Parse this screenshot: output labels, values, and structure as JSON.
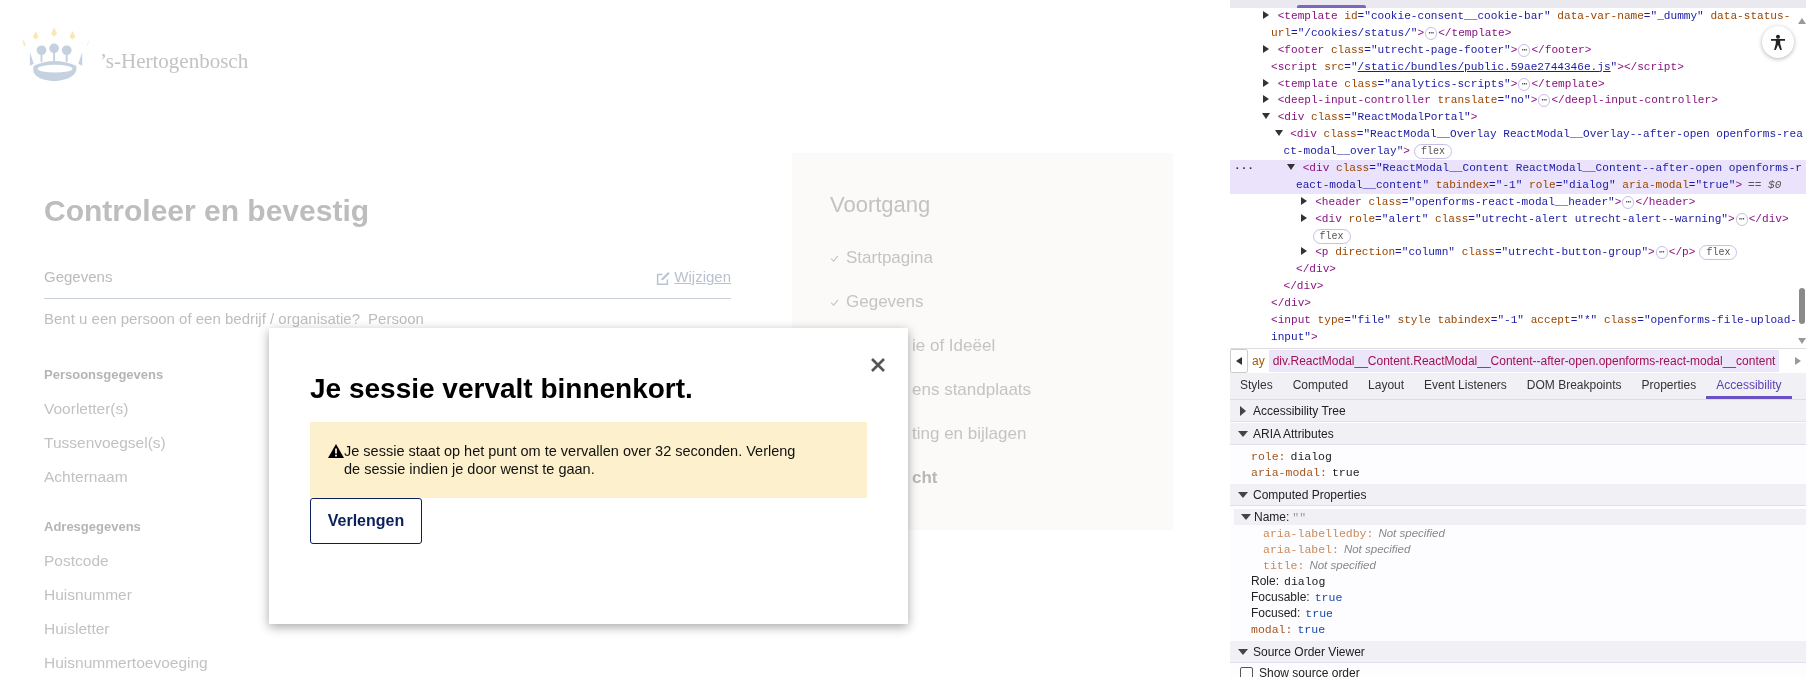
{
  "site": {
    "name": "’s-Hertogenbosch"
  },
  "summary": {
    "title": "Controleer en bevestig",
    "section_label": "Gegevens",
    "edit_link": "Wijzigen",
    "question": "Bent u een persoon of een bedrijf / organisatie?",
    "answer": "Persoon",
    "groups": [
      {
        "heading": "Persoonsgegevens",
        "fields": [
          "Voorletter(s)",
          "Tussenvoegsel(s)",
          "Achternaam"
        ]
      },
      {
        "heading": "Adresgegevens",
        "fields": [
          "Postcode",
          "Huisnummer",
          "Huisletter",
          "Huisnummertoevoeging"
        ]
      }
    ]
  },
  "progress": {
    "title": "Voortgang",
    "steps": [
      {
        "label": "Startpagina",
        "kind": "full",
        "done": true,
        "current": false
      },
      {
        "label": "Gegevens",
        "kind": "full",
        "done": true,
        "current": false
      },
      {
        "label": "ie of Ideëel",
        "kind": "covered",
        "done": false,
        "current": false
      },
      {
        "label": "ens standplaats",
        "kind": "covered",
        "done": false,
        "current": false
      },
      {
        "label": "ting en bijlagen",
        "kind": "covered",
        "done": false,
        "current": false
      },
      {
        "label": "cht",
        "kind": "covered",
        "done": false,
        "current": true
      }
    ]
  },
  "modal": {
    "title": "Je sessie vervalt binnenkort.",
    "alert": "Je sessie staat op het punt om te vervallen over 32 seconden. Verleng de sessie indien je door wenst te gaan.",
    "button": "Verlengen"
  },
  "devtools": {
    "dom_tree": [
      {
        "kind": "branch",
        "expanded": false,
        "selected": false,
        "lines": [
          [
            {
              "kind": "tag",
              "text": "<template"
            },
            {
              "kind": "attr",
              "text": " id"
            },
            {
              "kind": "value",
              "text": "=\"cookie-consent__cookie-bar\""
            },
            {
              "kind": "attr",
              "text": " data-var-name"
            },
            {
              "kind": "value",
              "text": "=\"_dummy\""
            },
            {
              "kind": "attr",
              "text": " data-status-"
            }
          ],
          [
            {
              "kind": "attr",
              "text": "url"
            },
            {
              "kind": "value",
              "text": "=\"/cookies/status/\""
            },
            {
              "kind": "tag",
              "text": ">"
            },
            {
              "kind": "ellipsis",
              "text": "⋯"
            },
            {
              "kind": "tag",
              "text": "</template>"
            }
          ]
        ]
      },
      {
        "kind": "branch",
        "expanded": false,
        "selected": false,
        "lines": [
          [
            {
              "kind": "tag",
              "text": "<footer"
            },
            {
              "kind": "attr",
              "text": " class"
            },
            {
              "kind": "value",
              "text": "=\"utrecht-page-footer\""
            },
            {
              "kind": "tag",
              "text": ">"
            },
            {
              "kind": "ellipsis",
              "text": "⋯"
            },
            {
              "kind": "tag",
              "text": "</footer>"
            }
          ]
        ]
      },
      {
        "kind": "leaf",
        "selected": false,
        "lines": [
          [
            {
              "kind": "tag",
              "text": "<script"
            },
            {
              "kind": "attr",
              "text": " src"
            },
            {
              "kind": "value",
              "text": "=\""
            },
            {
              "kind": "link",
              "text": "/static/bundles/public.59ae2744346e.js"
            },
            {
              "kind": "value",
              "text": "\""
            },
            {
              "kind": "tag",
              "text": "></script>"
            }
          ]
        ]
      },
      {
        "kind": "branch",
        "expanded": false,
        "selected": false,
        "lines": [
          [
            {
              "kind": "tag",
              "text": "<template"
            },
            {
              "kind": "attr",
              "text": " class"
            },
            {
              "kind": "value",
              "text": "=\"analytics-scripts\""
            },
            {
              "kind": "tag",
              "text": ">"
            },
            {
              "kind": "ellipsis",
              "text": "⋯"
            },
            {
              "kind": "tag",
              "text": "</template>"
            }
          ]
        ]
      },
      {
        "kind": "branch",
        "expanded": false,
        "selected": false,
        "lines": [
          [
            {
              "kind": "tag",
              "text": "<deepl-input-controller"
            },
            {
              "kind": "attr",
              "text": " translate"
            },
            {
              "kind": "value",
              "text": "=\"no\""
            },
            {
              "kind": "tag",
              "text": ">"
            },
            {
              "kind": "ellipsis",
              "text": "⋯"
            },
            {
              "kind": "tag",
              "text": "</deepl-input-controller>"
            }
          ]
        ]
      },
      {
        "kind": "branch",
        "expanded": true,
        "selected": false,
        "close": "</div>",
        "lines": [
          [
            {
              "kind": "tag",
              "text": "<div"
            },
            {
              "kind": "attr",
              "text": " class"
            },
            {
              "kind": "value",
              "text": "=\"ReactModalPortal\""
            },
            {
              "kind": "tag",
              "text": ">"
            }
          ]
        ],
        "children": [
          {
            "kind": "branch",
            "expanded": true,
            "selected": false,
            "close": "</div>",
            "lines": [
              [
                {
                  "kind": "tag",
                  "text": "<div"
                },
                {
                  "kind": "attr",
                  "text": " class"
                },
                {
                  "kind": "value",
                  "text": "=\"ReactModal__Overlay ReactModal__Overlay--after-open openforms-rea"
                }
              ],
              [
                {
                  "kind": "value",
                  "text": "ct-modal__overlay\""
                },
                {
                  "kind": "tag",
                  "text": ">"
                },
                {
                  "kind": "badge",
                  "text": "flex"
                }
              ]
            ],
            "children": [
              {
                "kind": "branch",
                "expanded": true,
                "selected": true,
                "gutter": "···",
                "close": "</div>",
                "lines": [
                  [
                    {
                      "kind": "tag",
                      "text": "<div"
                    },
                    {
                      "kind": "attr",
                      "text": " class"
                    },
                    {
                      "kind": "value",
                      "text": "=\"ReactModal__Content ReactModal__Content--after-open openforms-r"
                    }
                  ],
                  [
                    {
                      "kind": "value",
                      "text": "eact-modal__content\""
                    },
                    {
                      "kind": "attr",
                      "text": " tabindex"
                    },
                    {
                      "kind": "value",
                      "text": "=\"-1\""
                    },
                    {
                      "kind": "attr",
                      "text": " role"
                    },
                    {
                      "kind": "value",
                      "text": "=\"dialog\""
                    },
                    {
                      "kind": "attr",
                      "text": " aria-modal"
                    },
                    {
                      "kind": "value",
                      "text": "=\"true\""
                    },
                    {
                      "kind": "tag",
                      "text": ">"
                    },
                    {
                      "kind": "note",
                      "text": "== $0"
                    }
                  ]
                ],
                "children": [
                  {
                    "kind": "branch",
                    "expanded": false,
                    "selected": false,
                    "lines": [
                      [
                        {
                          "kind": "tag",
                          "text": "<header"
                        },
                        {
                          "kind": "attr",
                          "text": " class"
                        },
                        {
                          "kind": "value",
                          "text": "=\"openforms-react-modal__header\""
                        },
                        {
                          "kind": "tag",
                          "text": ">"
                        },
                        {
                          "kind": "ellipsis",
                          "text": "⋯"
                        },
                        {
                          "kind": "tag",
                          "text": "</header>"
                        }
                      ]
                    ]
                  },
                  {
                    "kind": "branch",
                    "expanded": false,
                    "selected": false,
                    "lines": [
                      [
                        {
                          "kind": "tag",
                          "text": "<div"
                        },
                        {
                          "kind": "attr",
                          "text": " role"
                        },
                        {
                          "kind": "value",
                          "text": "=\"alert\""
                        },
                        {
                          "kind": "attr",
                          "text": " class"
                        },
                        {
                          "kind": "value",
                          "text": "=\"utrecht-alert utrecht-alert--warning\""
                        },
                        {
                          "kind": "tag",
                          "text": ">"
                        },
                        {
                          "kind": "ellipsis",
                          "text": "⋯"
                        },
                        {
                          "kind": "tag",
                          "text": "</div>"
                        }
                      ],
                      [
                        {
                          "kind": "badge",
                          "text": "flex"
                        }
                      ]
                    ]
                  },
                  {
                    "kind": "branch",
                    "expanded": false,
                    "selected": false,
                    "lines": [
                      [
                        {
                          "kind": "tag",
                          "text": "<p"
                        },
                        {
                          "kind": "attr",
                          "text": " direction"
                        },
                        {
                          "kind": "value",
                          "text": "=\"column\""
                        },
                        {
                          "kind": "attr",
                          "text": " class"
                        },
                        {
                          "kind": "value",
                          "text": "=\"utrecht-button-group\""
                        },
                        {
                          "kind": "tag",
                          "text": ">"
                        },
                        {
                          "kind": "ellipsis",
                          "text": "⋯"
                        },
                        {
                          "kind": "tag",
                          "text": "</p>"
                        },
                        {
                          "kind": "badge",
                          "text": "flex"
                        }
                      ]
                    ]
                  }
                ]
              }
            ]
          }
        ]
      },
      {
        "kind": "leaf",
        "selected": false,
        "lines": [
          [
            {
              "kind": "tag",
              "text": "<input"
            },
            {
              "kind": "attr",
              "text": " type"
            },
            {
              "kind": "value",
              "text": "=\"file\""
            },
            {
              "kind": "attr",
              "text": " style"
            },
            {
              "kind": "attr",
              "text": " tabindex"
            },
            {
              "kind": "value",
              "text": "=\"-1\""
            },
            {
              "kind": "attr",
              "text": " accept"
            },
            {
              "kind": "value",
              "text": "=\"*\""
            },
            {
              "kind": "attr",
              "text": " class"
            },
            {
              "kind": "value",
              "text": "=\"openforms-file-upload-"
            }
          ],
          [
            {
              "kind": "value",
              "text": "input\""
            },
            {
              "kind": "tag",
              "text": ">"
            }
          ]
        ]
      }
    ],
    "breadcrumbs": [
      {
        "text": "ay",
        "selected": false
      },
      {
        "text": "div.ReactModal__Content.ReactModal__Content--after-open.openforms-react-modal__content",
        "selected": true
      }
    ],
    "tabs": [
      {
        "label": "Styles",
        "selected": false
      },
      {
        "label": "Computed",
        "selected": false
      },
      {
        "label": "Layout",
        "selected": false
      },
      {
        "label": "Event Listeners",
        "selected": false
      },
      {
        "label": "DOM Breakpoints",
        "selected": false
      },
      {
        "label": "Properties",
        "selected": false
      },
      {
        "label": "Accessibility",
        "selected": true
      }
    ],
    "sections": [
      {
        "title": "Accessibility Tree",
        "expanded": false
      },
      {
        "title": "ARIA Attributes",
        "expanded": true,
        "rows": [
          {
            "kind": "attribute",
            "name": "role:",
            "value": {
              "kind": "text",
              "text": "dialog"
            }
          },
          {
            "kind": "attribute",
            "name": "aria-modal:",
            "value": {
              "kind": "text",
              "text": "true"
            }
          }
        ]
      },
      {
        "title": "Computed Properties",
        "expanded": true,
        "rows": [
          {
            "kind": "group",
            "name": "Name:",
            "value": {
              "kind": "empty",
              "text": "\"\""
            },
            "expanded": true,
            "children": [
              {
                "kind": "attribute",
                "name": "aria-labelledby:",
                "value": {
                  "kind": "unspecified",
                  "text": "Not specified"
                }
              },
              {
                "kind": "attribute",
                "name": "aria-label:",
                "value": {
                  "kind": "unspecified",
                  "text": "Not specified"
                }
              },
              {
                "kind": "attribute",
                "name": "title:",
                "value": {
                  "kind": "unspecified",
                  "text": "Not specified"
                }
              }
            ]
          },
          {
            "kind": "property",
            "name": "Role:",
            "value": {
              "kind": "text",
              "text": "dialog"
            }
          },
          {
            "kind": "property",
            "name": "Focusable:",
            "value": {
              "kind": "keyword",
              "text": "true"
            }
          },
          {
            "kind": "property",
            "name": "Focused:",
            "value": {
              "kind": "keyword",
              "text": "true"
            }
          },
          {
            "kind": "attribute",
            "name": "modal:",
            "value": {
              "kind": "keyword",
              "text": "true"
            }
          }
        ]
      },
      {
        "title": "Source Order Viewer",
        "expanded": true,
        "checkbox": {
          "label": "Show source order",
          "checked": false
        }
      }
    ]
  }
}
